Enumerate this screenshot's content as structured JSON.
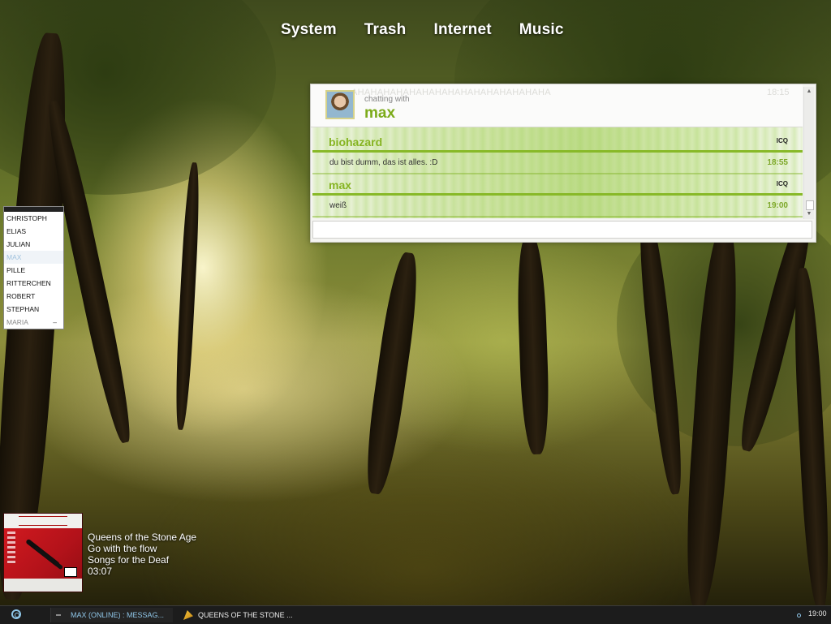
{
  "menu": {
    "items": [
      "System",
      "Trash",
      "Internet",
      "Music"
    ]
  },
  "chat": {
    "ghost_text": "AHAHAHAHAHAHAHAHAHAHAHAHAHAHAHA",
    "ghost_time": "18:15",
    "chatting_with_label": "chatting with",
    "contact_name": "max",
    "messages": [
      {
        "sender": "biohazard",
        "protocol": "ICQ",
        "text": "du bist dumm, das ist alles. :D",
        "time": "18:55"
      },
      {
        "sender": "max",
        "protocol": "ICQ",
        "text": "weiß",
        "time": "19:00"
      }
    ],
    "input_value": ""
  },
  "contacts": {
    "items": [
      "CHRISTOPH",
      "ELIAS",
      "JULIAN",
      "MAX",
      "PILLE",
      "RITTERCHEN",
      "ROBERT",
      "STEPHAN",
      "MARIA"
    ],
    "selected": "MAX",
    "last_item_suffix": "–"
  },
  "music": {
    "artist": "Queens of the Stone Age",
    "track": "Go with the flow",
    "album": "Songs for the Deaf",
    "time": "03:07"
  },
  "taskbar": {
    "task1_label": "MAX (ONLINE) : MESSAG...",
    "task2_label": "QUEENS OF THE STONE ...",
    "clock": "19:00"
  },
  "colors": {
    "accent": "#86b422",
    "taskbar_text": "#8fc6e8"
  }
}
